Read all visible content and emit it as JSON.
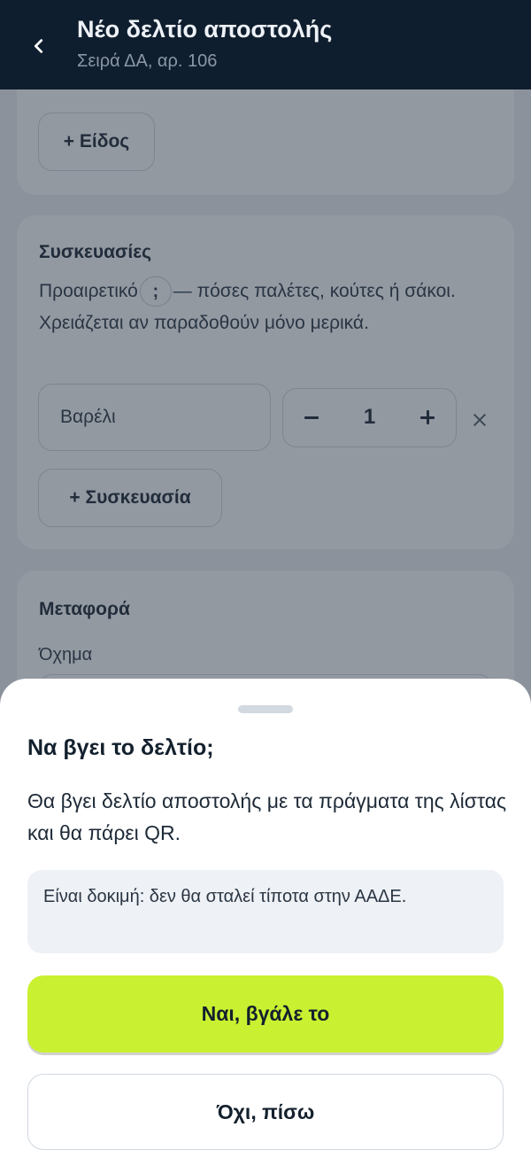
{
  "header": {
    "title": "Νέο δελτίο αποστολής",
    "subtitle": "Σειρά ΔΑ, αρ. 106",
    "back_icon": "chevron-left-icon"
  },
  "items_card": {
    "add_item_label": "+ Είδος"
  },
  "packaging_card": {
    "title": "Συσκευασίες",
    "desc_before": "Προαιρετικό",
    "chip_text": ";",
    "desc_after": "— πόσες παλέτες, κούτες ή σάκοι. Χρειάζεται αν παραδοθούν μόνο μερικά.",
    "package": {
      "type": "Βαρέλι",
      "quantity": "1"
    },
    "remove_icon": "close-icon",
    "add_package_label": "+ Συσκευασία"
  },
  "transport_card": {
    "title": "Μεταφορά",
    "vehicle_label": "Όχημα"
  },
  "dialog": {
    "title": "Να βγει το δελτίο;",
    "body": "Θα βγει δελτίο αποστολής με τα πράγματα της λίστας και θα πάρει QR.",
    "note": "Είναι δοκιμή: δεν θα σταλεί τίποτα στην ΑΑΔΕ.",
    "confirm_label": "Ναι, βγάλε το",
    "cancel_label": "Όχι, πίσω"
  },
  "colors": {
    "header_bg": "#0f1e2e",
    "accent": "#c9f131",
    "overlay": "rgba(40,52,68,0.5)"
  }
}
